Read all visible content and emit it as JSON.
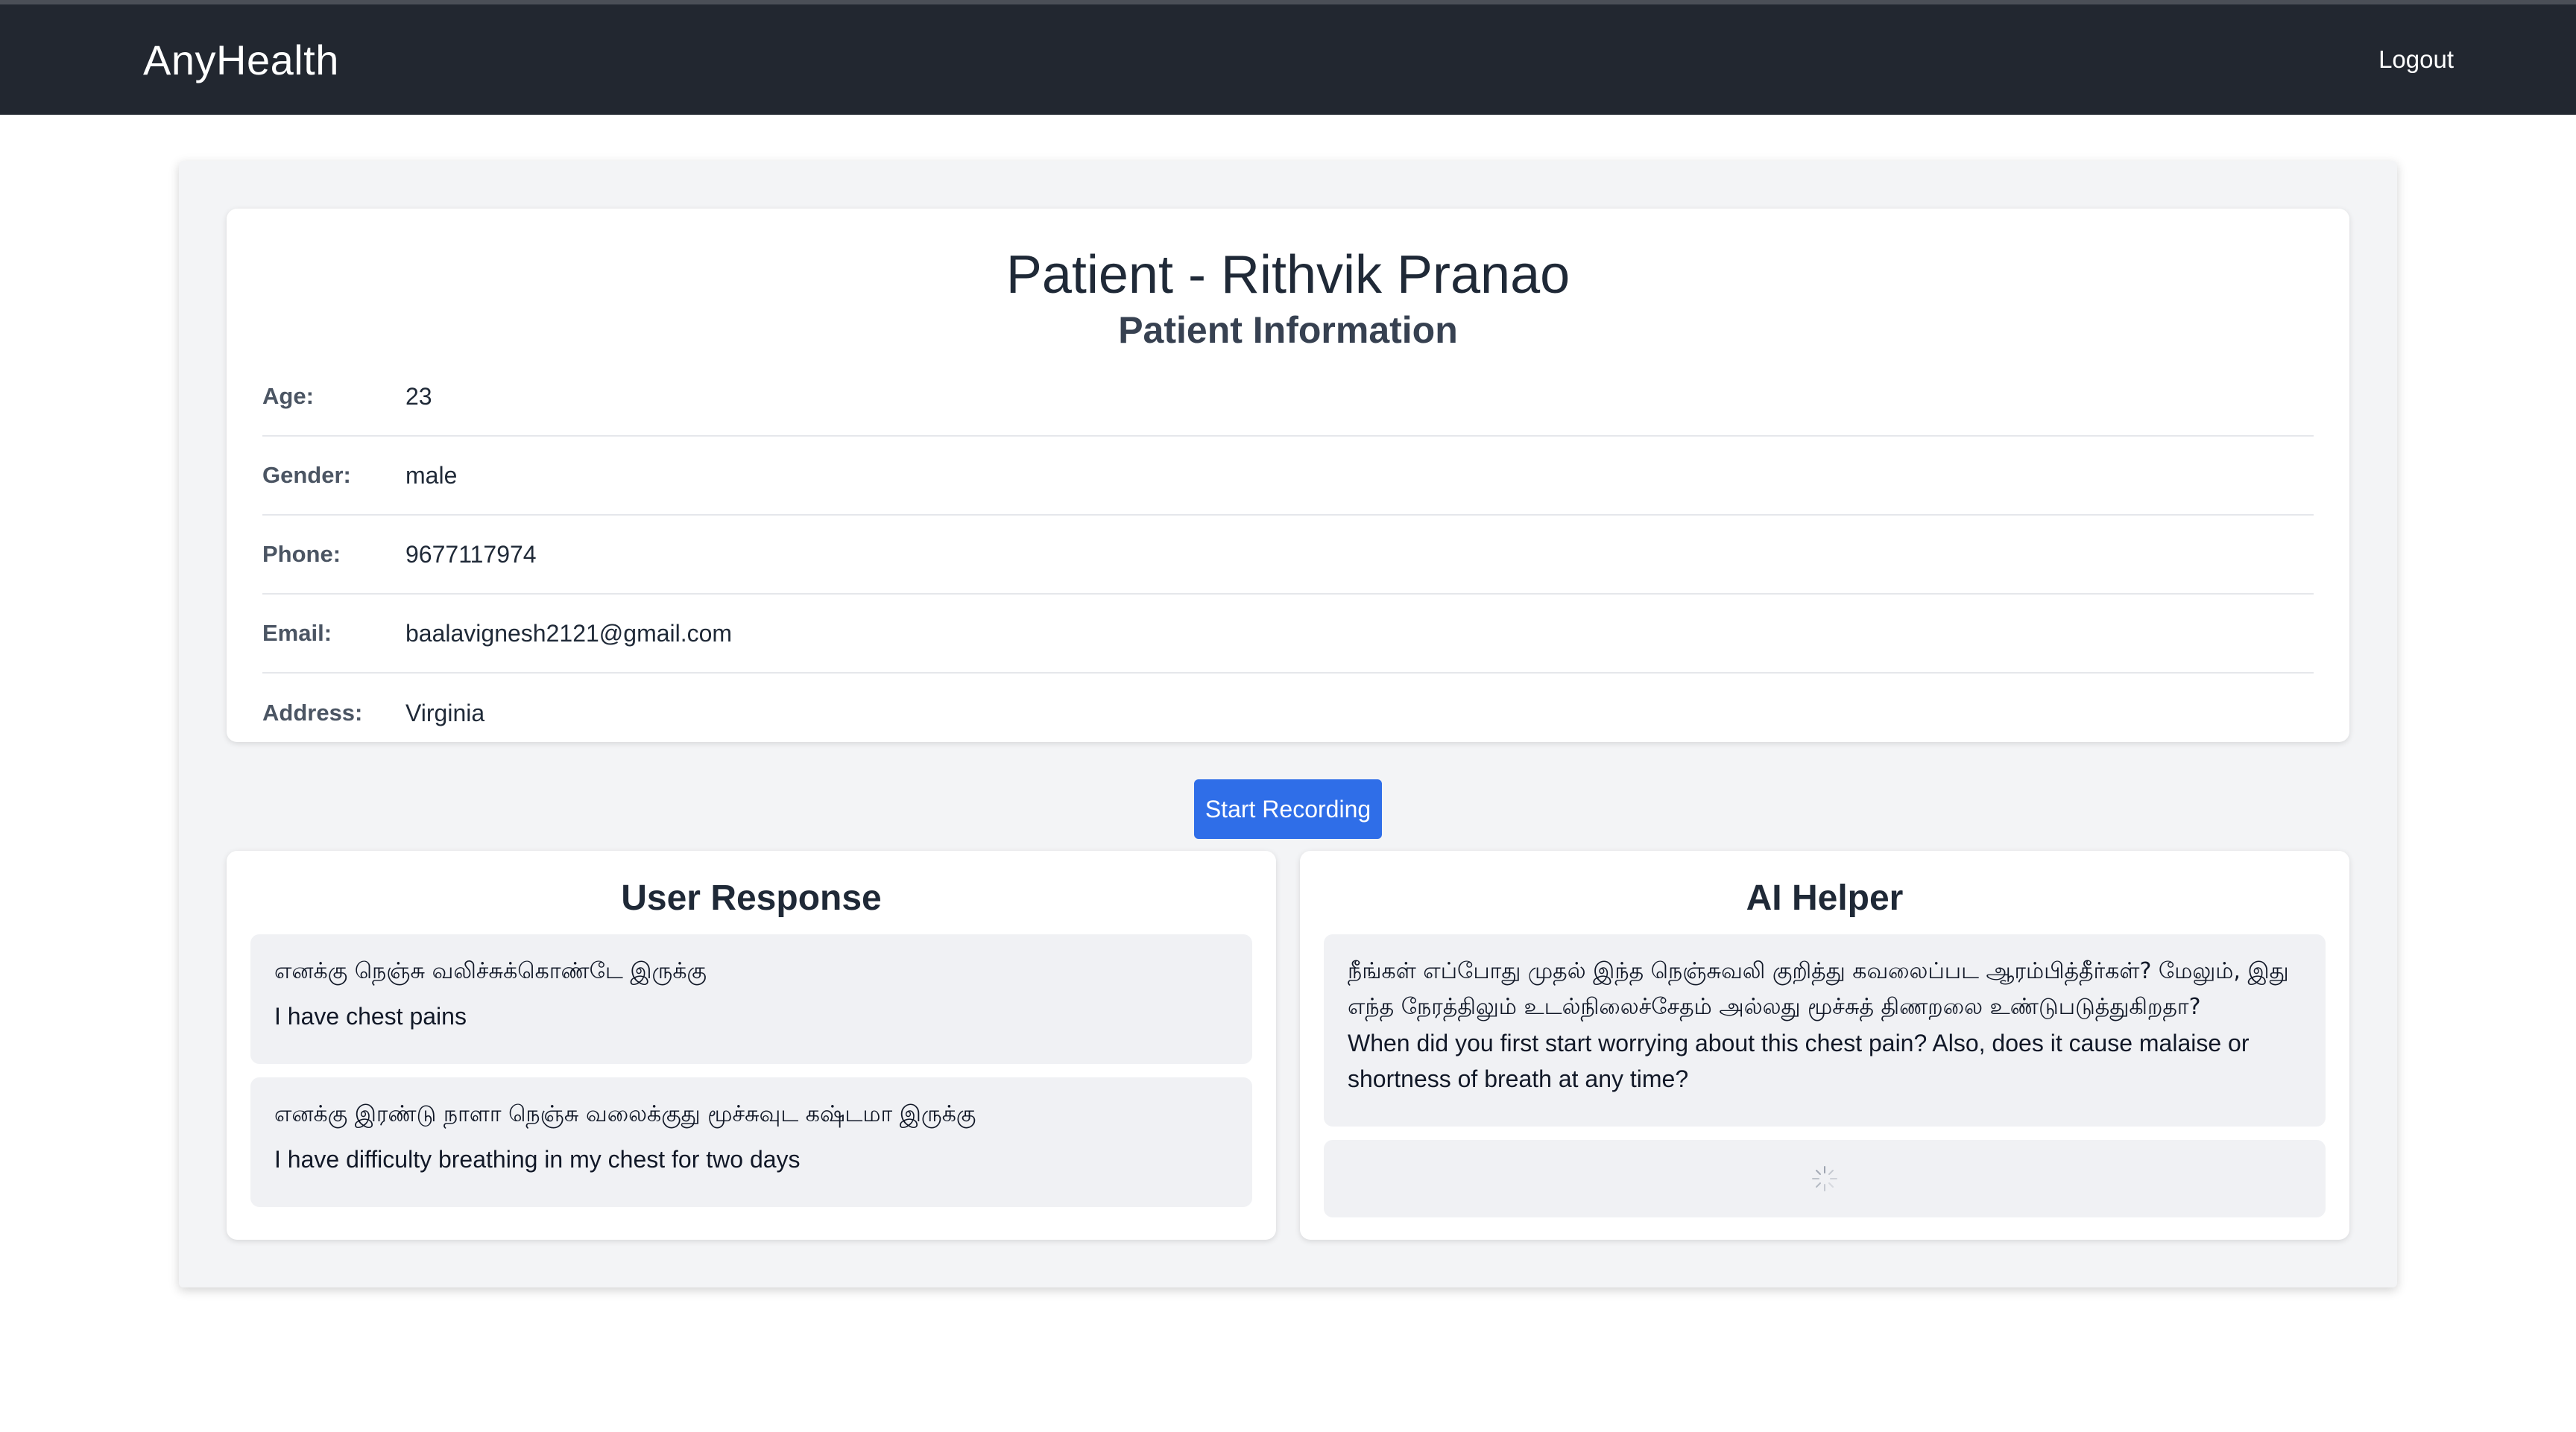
{
  "navbar": {
    "brand": "AnyHealth",
    "logout_label": "Logout"
  },
  "patient": {
    "title": "Patient - Rithvik Pranao",
    "subtitle": "Patient Information",
    "fields": [
      {
        "label": "Age:",
        "value": "23"
      },
      {
        "label": "Gender:",
        "value": "male"
      },
      {
        "label": "Phone:",
        "value": "9677117974"
      },
      {
        "label": "Email:",
        "value": "baalavignesh2121@gmail.com"
      },
      {
        "label": "Address:",
        "value": "Virginia"
      }
    ]
  },
  "recording": {
    "button_label": "Start Recording"
  },
  "user_response": {
    "title": "User Response",
    "messages": [
      {
        "tamil": "எனக்கு நெஞ்சு வலிச்சுக்கொண்டே இருக்கு",
        "english": "I have chest pains"
      },
      {
        "tamil": "எனக்கு இரண்டு நாளா நெஞ்சு வலைக்குது மூச்சுவுட கஷ்டமா இருக்கு",
        "english": "I have difficulty breathing in my chest for two days"
      }
    ]
  },
  "ai_helper": {
    "title": "AI Helper",
    "messages": [
      {
        "tamil": "நீங்கள் எப்போது முதல் இந்த நெஞ்சுவலி குறித்து கவலைப்பட ஆரம்பித்தீர்கள்? மேலும், இது எந்த நேரத்திலும் உடல்நிலைச்சேதம் அல்லது மூச்சுத் திணறலை உண்டுபடுத்துகிறதா?",
        "english": "When did you first start worrying about this chest pain? Also, does it cause malaise or shortness of breath at any time?"
      }
    ],
    "loading_icon": "spinner-icon"
  },
  "colors": {
    "navbar_bg": "#222730",
    "button_bg": "#2f6ee8",
    "page_bg": "#f3f4f6",
    "message_bg": "#f0f1f4"
  }
}
